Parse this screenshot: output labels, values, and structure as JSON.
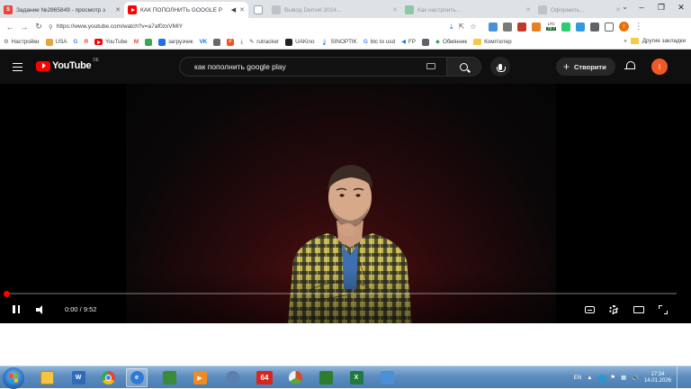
{
  "browser": {
    "tabs": [
      {
        "title": "Задание №2865849 - просмотр з",
        "favicon": "sp-icon",
        "active": false
      },
      {
        "title": "КАК ПОПОЛНИТЬ GOOGLE P",
        "favicon": "youtube-icon",
        "active": true
      },
      {
        "title": "",
        "favicon": "page-icon",
        "active": false
      },
      {
        "title": "Вывод Denvel 2024...",
        "favicon": "page-icon",
        "active": false
      },
      {
        "title": "Как настроить...",
        "favicon": "page-icon",
        "active": false
      },
      {
        "title": "Оформить...",
        "favicon": "page-icon",
        "active": false
      }
    ],
    "url": "https://www.youtube.com/watch?v=a7af0zxVMIY",
    "extension_labels": {
      "ltc": "LTC",
      "ltc_value": "79.7"
    }
  },
  "bookmarks": {
    "items": [
      {
        "label": "Настройки",
        "icon": "settings-icon",
        "color": "#5f6368"
      },
      {
        "label": "USA",
        "icon": "page-icon",
        "color": "#e8a33c"
      },
      {
        "label": "G",
        "icon": "google-icon",
        "color": "#4285f4"
      },
      {
        "label": "Я",
        "icon": "yandex-icon",
        "color": "#fc3f1d"
      },
      {
        "label": "YouTube",
        "icon": "youtube-icon",
        "color": "#ff0000"
      },
      {
        "label": "M",
        "icon": "gmail-icon",
        "color": "#ea4335"
      },
      {
        "label": "",
        "icon": "drive-icon",
        "color": "#34a853"
      },
      {
        "label": "загрузчик",
        "icon": "page-icon",
        "color": "#1a73e8"
      },
      {
        "label": "VK",
        "icon": "vk-icon",
        "color": "#0077ff"
      },
      {
        "label": "",
        "icon": "page-icon",
        "color": "#6a6a6a"
      },
      {
        "label": "F",
        "icon": "page-icon",
        "color": "#f4511e"
      },
      {
        "label": "",
        "icon": "download-icon",
        "color": "#5f6368"
      },
      {
        "label": "rutracker",
        "icon": "page-icon",
        "color": "#3c4043"
      },
      {
        "label": "UAKino",
        "icon": "page-icon",
        "color": "#202124"
      },
      {
        "label": "SINOPTIK",
        "icon": "page-icon",
        "color": "#1a73e8"
      },
      {
        "label": "btc to usd",
        "icon": "google-icon",
        "color": "#4285f4"
      },
      {
        "label": "FP",
        "icon": "page-icon",
        "color": "#1a73e8"
      },
      {
        "label": "",
        "icon": "page-icon",
        "color": "#5f6368"
      },
      {
        "label": "Обмінник",
        "icon": "page-icon",
        "color": "#34a853"
      },
      {
        "label": "Комп'ютер",
        "icon": "folder-icon",
        "color": "#f9c846"
      }
    ],
    "more": "»",
    "other": "Другие закладки"
  },
  "youtube": {
    "logo": "YouTube",
    "region": "DE",
    "search_query": "как пополнить google play",
    "create_label": "Створити",
    "avatar_letter": "I"
  },
  "player": {
    "current_time": "0:00",
    "duration": "9:52",
    "time_display": "0:00 / 9:52",
    "progress_fraction": 0.0
  },
  "taskbar": {
    "language": "EN",
    "time": "17:34",
    "date": "14.01.2026",
    "apps": [
      {
        "name": "explorer-icon",
        "color": "#f6c343",
        "label": ""
      },
      {
        "name": "wm-icon",
        "color": "#2e6bb8",
        "label": "W"
      },
      {
        "name": "chrome-icon",
        "color": "",
        "label": ""
      },
      {
        "name": "ie-icon",
        "color": "#2f7ad6",
        "label": "e"
      },
      {
        "name": "monitor-icon",
        "color": "#3a8a3a",
        "label": ""
      },
      {
        "name": "media-player-icon",
        "color": "#f08a24",
        "label": "▶"
      },
      {
        "name": "app-icon",
        "color": "#5a7fb0",
        "label": ""
      },
      {
        "name": "aida64-icon",
        "color": "#d7261e",
        "label": "64"
      },
      {
        "name": "pictures-icon",
        "color": "#d94a2c",
        "label": ""
      },
      {
        "name": "terminal-icon",
        "color": "#2d7d2d",
        "label": ""
      },
      {
        "name": "excel-icon",
        "color": "#1f7a3f",
        "label": "X"
      },
      {
        "name": "window-icon",
        "color": "#4b8fd6",
        "label": ""
      }
    ]
  }
}
